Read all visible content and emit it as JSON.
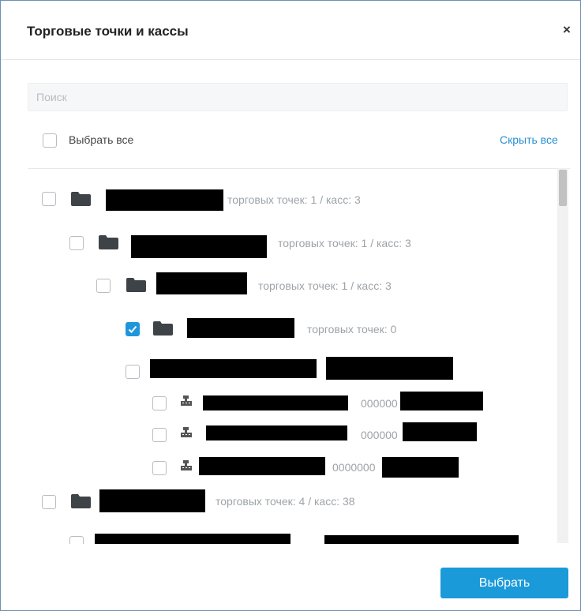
{
  "dialog": {
    "title": "Торговые точки и кассы",
    "close_glyph": "×"
  },
  "search": {
    "placeholder": "Поиск",
    "value": ""
  },
  "select_all": {
    "label": "Выбрать все",
    "checked": false
  },
  "hide_all_link": "Скрыть все",
  "tree": {
    "rows": [
      {
        "level": 0,
        "type": "folder",
        "checked": false,
        "meta": "торговых точек: 1 / касс: 3"
      },
      {
        "level": 1,
        "type": "folder",
        "checked": false,
        "meta": "торговых точек: 1 / касс: 3"
      },
      {
        "level": 2,
        "type": "folder",
        "checked": false,
        "meta": "торговых точек: 1 / касс: 3"
      },
      {
        "level": 3,
        "type": "folder",
        "checked": true,
        "meta": "торговых точек: 0"
      },
      {
        "level": 3,
        "type": "store",
        "checked": false
      },
      {
        "level": 4,
        "type": "register",
        "checked": false,
        "code": "000000"
      },
      {
        "level": 4,
        "type": "register",
        "checked": false,
        "code": "000000"
      },
      {
        "level": 4,
        "type": "register",
        "checked": false,
        "code": "0000000"
      },
      {
        "level": 0,
        "type": "folder",
        "checked": false,
        "meta": "торговых точек: 4 / касс: 38"
      },
      {
        "level": 1,
        "type": "store",
        "checked": false
      }
    ]
  },
  "footer": {
    "select_button": "Выбрать"
  },
  "colors": {
    "accent": "#1a9ad9",
    "link": "#2a8fd1",
    "checked": "#1e96dc"
  },
  "icons": {
    "folder": "folder-icon",
    "register": "cash-register-icon",
    "check": "check-icon"
  }
}
